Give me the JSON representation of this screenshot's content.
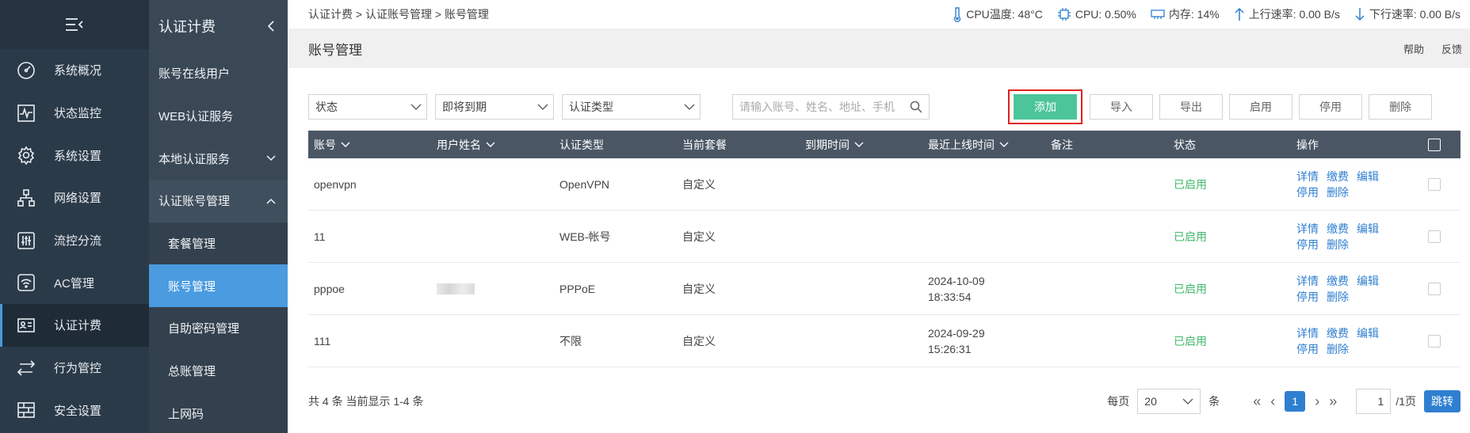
{
  "nav1": {
    "menu_icon": "menu-collapse-icon",
    "items": [
      {
        "label": "系统概况",
        "icon": "dashboard-icon"
      },
      {
        "label": "状态监控",
        "icon": "monitor-icon"
      },
      {
        "label": "系统设置",
        "icon": "gear-icon"
      },
      {
        "label": "网络设置",
        "icon": "network-icon"
      },
      {
        "label": "流控分流",
        "icon": "sliders-icon"
      },
      {
        "label": "AC管理",
        "icon": "wifi-icon"
      },
      {
        "label": "认证计费",
        "icon": "id-card-icon"
      },
      {
        "label": "行为管控",
        "icon": "arrows-icon"
      },
      {
        "label": "安全设置",
        "icon": "firewall-icon"
      }
    ]
  },
  "nav2": {
    "title": "认证计费",
    "items": [
      {
        "label": "账号在线用户"
      },
      {
        "label": "WEB认证服务"
      },
      {
        "label": "本地认证服务"
      },
      {
        "label": "认证账号管理"
      },
      {
        "label": "套餐管理"
      },
      {
        "label": "账号管理"
      },
      {
        "label": "自助密码管理"
      },
      {
        "label": "总账管理"
      },
      {
        "label": "上网码"
      }
    ]
  },
  "topbar": {
    "breadcrumb": "认证计费 > 认证账号管理 > 账号管理",
    "cpu_temp": "CPU温度: 48°C",
    "cpu": "CPU: 0.50%",
    "mem": "内存: 14%",
    "up": "上行速率: 0.00 B/s",
    "down": "下行速率: 0.00 B/s"
  },
  "title": {
    "text": "账号管理",
    "help": "帮助",
    "feedback": "反馈"
  },
  "filters": {
    "status": "状态",
    "expire": "即将到期",
    "auth_type": "认证类型",
    "search_placeholder": "请输入账号、姓名、地址、手机"
  },
  "buttons": {
    "add": "添加",
    "import": "导入",
    "export": "导出",
    "enable": "启用",
    "disable": "停用",
    "delete": "删除"
  },
  "table": {
    "headers": [
      "账号",
      "用户姓名",
      "认证类型",
      "当前套餐",
      "到期时间",
      "最近上线时间",
      "备注",
      "状态",
      "操作"
    ],
    "rows": [
      {
        "account": "openvpn",
        "name": "",
        "auth": "OpenVPN",
        "plan": "自定义",
        "expire": "",
        "last_date": "",
        "last_time": "",
        "note": "",
        "status": "已启用"
      },
      {
        "account": "11",
        "name": "",
        "auth": "WEB-帐号",
        "plan": "自定义",
        "expire": "",
        "last_date": "",
        "last_time": "",
        "note": "",
        "status": "已启用"
      },
      {
        "account": "pppoe",
        "name": "",
        "auth": "PPPoE",
        "plan": "自定义",
        "expire": "",
        "last_date": "2024-10-09",
        "last_time": "18:33:54",
        "note": "",
        "status": "已启用"
      },
      {
        "account": "111",
        "name": "",
        "auth": "不限",
        "plan": "自定义",
        "expire": "",
        "last_date": "2024-09-29",
        "last_time": "15:26:31",
        "note": "",
        "status": "已启用"
      }
    ],
    "ops": {
      "detail": "详情",
      "pay": "缴费",
      "edit": "编辑",
      "disable": "停用",
      "delete": "删除"
    }
  },
  "footer": {
    "summary": "共 4 条 当前显示 1-4 条",
    "per_page_label": "每页",
    "per_page": "20",
    "unit": "条",
    "current_page": "1",
    "page_input": "1",
    "total_pages": "/1页",
    "jump": "跳转"
  },
  "colors": {
    "accent": "#4a9be0",
    "add_button": "#4cc59a",
    "status_enabled": "#41b86a",
    "link": "#2f7fd0",
    "highlight_border": "#e02020"
  }
}
